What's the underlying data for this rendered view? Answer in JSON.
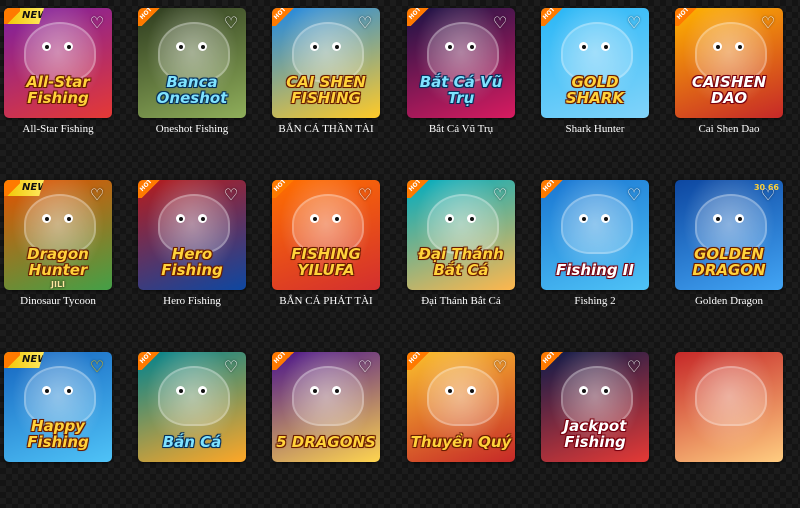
{
  "games": [
    {
      "title": "All-Star Fishing",
      "logo": "All-Star Fishing",
      "sublogo": "",
      "badge": "NEW",
      "heart": "♡",
      "bg": "#7b1fa2",
      "bg2": "#e53935",
      "logo_style": ""
    },
    {
      "title": "Oneshot Fishing",
      "logo": "Banca Oneshot",
      "sublogo": "",
      "badge": "HOT",
      "heart": "♡",
      "bg": "#2e3b1f",
      "bg2": "#8fae5a",
      "logo_style": "blue"
    },
    {
      "title": "BẮN CÁ THẦN TÀI",
      "logo": "CAI SHEN FISHING",
      "sublogo": "",
      "badge": "HOT",
      "heart": "♡",
      "bg": "#1e88e5",
      "bg2": "#ffca28",
      "logo_style": ""
    },
    {
      "title": "Bắt Cá Vũ Trụ",
      "logo": "Bắt Cá Vũ Trụ",
      "sublogo": "",
      "badge": "HOT",
      "heart": "♡",
      "bg": "#1a1446",
      "bg2": "#d81b60",
      "logo_style": "blue"
    },
    {
      "title": "Shark Hunter",
      "logo": "GOLD SHARK",
      "sublogo": "",
      "badge": "HOT",
      "heart": "♡",
      "bg": "#29b6f6",
      "bg2": "#81d4fa",
      "logo_style": ""
    },
    {
      "title": "Cai Shen Dao",
      "logo": "CAISHEN DAO",
      "sublogo": "",
      "badge": "HOT",
      "heart": "♡",
      "bg": "#ffb300",
      "bg2": "#c62828",
      "logo_style": "white"
    },
    {
      "title": "Dinosaur Tycoon",
      "logo": "Dragon Hunter",
      "sublogo": "JILI",
      "badge": "NEW",
      "heart": "♡",
      "bg": "#e65100",
      "bg2": "#43a047",
      "logo_style": ""
    },
    {
      "title": "Hero Fishing",
      "logo": "Hero Fishing",
      "sublogo": "",
      "badge": "HOT",
      "heart": "♡",
      "bg": "#b71c1c",
      "bg2": "#0d47a1",
      "logo_style": ""
    },
    {
      "title": "BẮN CÁ PHÁT TÀI",
      "logo": "FISHING YILUFA",
      "sublogo": "",
      "badge": "HOT",
      "heart": "♡",
      "bg": "#ff6f00",
      "bg2": "#d32f2f",
      "logo_style": ""
    },
    {
      "title": "Đại Thánh Bắt Cá",
      "logo": "Đại Thánh Bắt Cá",
      "sublogo": "",
      "badge": "HOT",
      "heart": "♡",
      "bg": "#00acc1",
      "bg2": "#ffb74d",
      "logo_style": ""
    },
    {
      "title": "Fishing 2",
      "logo": "Fishing II",
      "sublogo": "",
      "badge": "HOT",
      "heart": "♡",
      "bg": "#1976d2",
      "bg2": "#4fc3f7",
      "logo_style": "white"
    },
    {
      "title": "Golden Dragon",
      "logo": "GOLDEN DRAGON",
      "sublogo": "",
      "badge": "",
      "heart": "♡",
      "coin": "30 66",
      "bg": "#0d47a1",
      "bg2": "#42a5f5",
      "logo_style": ""
    },
    {
      "title": "",
      "logo": "Happy Fishing",
      "sublogo": "",
      "badge": "NEW",
      "heart": "♡",
      "bg": "#1565c0",
      "bg2": "#4fc3f7",
      "logo_style": "",
      "gold": true
    },
    {
      "title": "",
      "logo": "Bắn Cá",
      "sublogo": "",
      "badge": "HOT",
      "heart": "♡",
      "bg": "#00838f",
      "bg2": "#ffa726",
      "logo_style": "blue"
    },
    {
      "title": "",
      "logo": "5 DRAGONS",
      "sublogo": "",
      "badge": "HOT",
      "heart": "♡",
      "bg": "#4a148c",
      "bg2": "#ffd54f",
      "logo_style": ""
    },
    {
      "title": "",
      "logo": "Thuyền Quý",
      "sublogo": "",
      "badge": "HOT",
      "heart": "♡",
      "bg": "#fbc02d",
      "bg2": "#c62828",
      "logo_style": ""
    },
    {
      "title": "",
      "logo": "Jackpot Fishing",
      "sublogo": "",
      "badge": "HOT",
      "heart": "♡",
      "bg": "#0d1b4a",
      "bg2": "#e53935",
      "logo_style": "white"
    },
    {
      "title": "",
      "logo": "",
      "sublogo": "",
      "badge": "",
      "heart": "",
      "bg": "#c62828",
      "bg2": "#ffcc80",
      "logo_style": ""
    }
  ]
}
